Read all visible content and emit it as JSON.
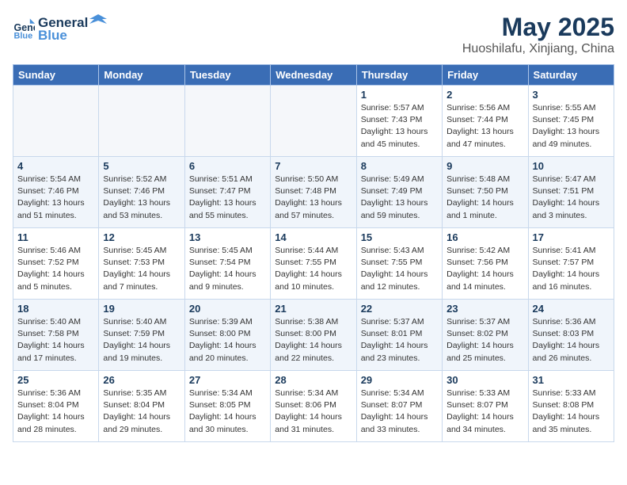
{
  "header": {
    "logo_line1": "General",
    "logo_line2": "Blue",
    "month": "May 2025",
    "location": "Huoshilafu, Xinjiang, China"
  },
  "weekdays": [
    "Sunday",
    "Monday",
    "Tuesday",
    "Wednesday",
    "Thursday",
    "Friday",
    "Saturday"
  ],
  "weeks": [
    [
      {
        "day": "",
        "info": ""
      },
      {
        "day": "",
        "info": ""
      },
      {
        "day": "",
        "info": ""
      },
      {
        "day": "",
        "info": ""
      },
      {
        "day": "1",
        "info": "Sunrise: 5:57 AM\nSunset: 7:43 PM\nDaylight: 13 hours\nand 45 minutes."
      },
      {
        "day": "2",
        "info": "Sunrise: 5:56 AM\nSunset: 7:44 PM\nDaylight: 13 hours\nand 47 minutes."
      },
      {
        "day": "3",
        "info": "Sunrise: 5:55 AM\nSunset: 7:45 PM\nDaylight: 13 hours\nand 49 minutes."
      }
    ],
    [
      {
        "day": "4",
        "info": "Sunrise: 5:54 AM\nSunset: 7:46 PM\nDaylight: 13 hours\nand 51 minutes."
      },
      {
        "day": "5",
        "info": "Sunrise: 5:52 AM\nSunset: 7:46 PM\nDaylight: 13 hours\nand 53 minutes."
      },
      {
        "day": "6",
        "info": "Sunrise: 5:51 AM\nSunset: 7:47 PM\nDaylight: 13 hours\nand 55 minutes."
      },
      {
        "day": "7",
        "info": "Sunrise: 5:50 AM\nSunset: 7:48 PM\nDaylight: 13 hours\nand 57 minutes."
      },
      {
        "day": "8",
        "info": "Sunrise: 5:49 AM\nSunset: 7:49 PM\nDaylight: 13 hours\nand 59 minutes."
      },
      {
        "day": "9",
        "info": "Sunrise: 5:48 AM\nSunset: 7:50 PM\nDaylight: 14 hours\nand 1 minute."
      },
      {
        "day": "10",
        "info": "Sunrise: 5:47 AM\nSunset: 7:51 PM\nDaylight: 14 hours\nand 3 minutes."
      }
    ],
    [
      {
        "day": "11",
        "info": "Sunrise: 5:46 AM\nSunset: 7:52 PM\nDaylight: 14 hours\nand 5 minutes."
      },
      {
        "day": "12",
        "info": "Sunrise: 5:45 AM\nSunset: 7:53 PM\nDaylight: 14 hours\nand 7 minutes."
      },
      {
        "day": "13",
        "info": "Sunrise: 5:45 AM\nSunset: 7:54 PM\nDaylight: 14 hours\nand 9 minutes."
      },
      {
        "day": "14",
        "info": "Sunrise: 5:44 AM\nSunset: 7:55 PM\nDaylight: 14 hours\nand 10 minutes."
      },
      {
        "day": "15",
        "info": "Sunrise: 5:43 AM\nSunset: 7:55 PM\nDaylight: 14 hours\nand 12 minutes."
      },
      {
        "day": "16",
        "info": "Sunrise: 5:42 AM\nSunset: 7:56 PM\nDaylight: 14 hours\nand 14 minutes."
      },
      {
        "day": "17",
        "info": "Sunrise: 5:41 AM\nSunset: 7:57 PM\nDaylight: 14 hours\nand 16 minutes."
      }
    ],
    [
      {
        "day": "18",
        "info": "Sunrise: 5:40 AM\nSunset: 7:58 PM\nDaylight: 14 hours\nand 17 minutes."
      },
      {
        "day": "19",
        "info": "Sunrise: 5:40 AM\nSunset: 7:59 PM\nDaylight: 14 hours\nand 19 minutes."
      },
      {
        "day": "20",
        "info": "Sunrise: 5:39 AM\nSunset: 8:00 PM\nDaylight: 14 hours\nand 20 minutes."
      },
      {
        "day": "21",
        "info": "Sunrise: 5:38 AM\nSunset: 8:00 PM\nDaylight: 14 hours\nand 22 minutes."
      },
      {
        "day": "22",
        "info": "Sunrise: 5:37 AM\nSunset: 8:01 PM\nDaylight: 14 hours\nand 23 minutes."
      },
      {
        "day": "23",
        "info": "Sunrise: 5:37 AM\nSunset: 8:02 PM\nDaylight: 14 hours\nand 25 minutes."
      },
      {
        "day": "24",
        "info": "Sunrise: 5:36 AM\nSunset: 8:03 PM\nDaylight: 14 hours\nand 26 minutes."
      }
    ],
    [
      {
        "day": "25",
        "info": "Sunrise: 5:36 AM\nSunset: 8:04 PM\nDaylight: 14 hours\nand 28 minutes."
      },
      {
        "day": "26",
        "info": "Sunrise: 5:35 AM\nSunset: 8:04 PM\nDaylight: 14 hours\nand 29 minutes."
      },
      {
        "day": "27",
        "info": "Sunrise: 5:34 AM\nSunset: 8:05 PM\nDaylight: 14 hours\nand 30 minutes."
      },
      {
        "day": "28",
        "info": "Sunrise: 5:34 AM\nSunset: 8:06 PM\nDaylight: 14 hours\nand 31 minutes."
      },
      {
        "day": "29",
        "info": "Sunrise: 5:34 AM\nSunset: 8:07 PM\nDaylight: 14 hours\nand 33 minutes."
      },
      {
        "day": "30",
        "info": "Sunrise: 5:33 AM\nSunset: 8:07 PM\nDaylight: 14 hours\nand 34 minutes."
      },
      {
        "day": "31",
        "info": "Sunrise: 5:33 AM\nSunset: 8:08 PM\nDaylight: 14 hours\nand 35 minutes."
      }
    ]
  ]
}
